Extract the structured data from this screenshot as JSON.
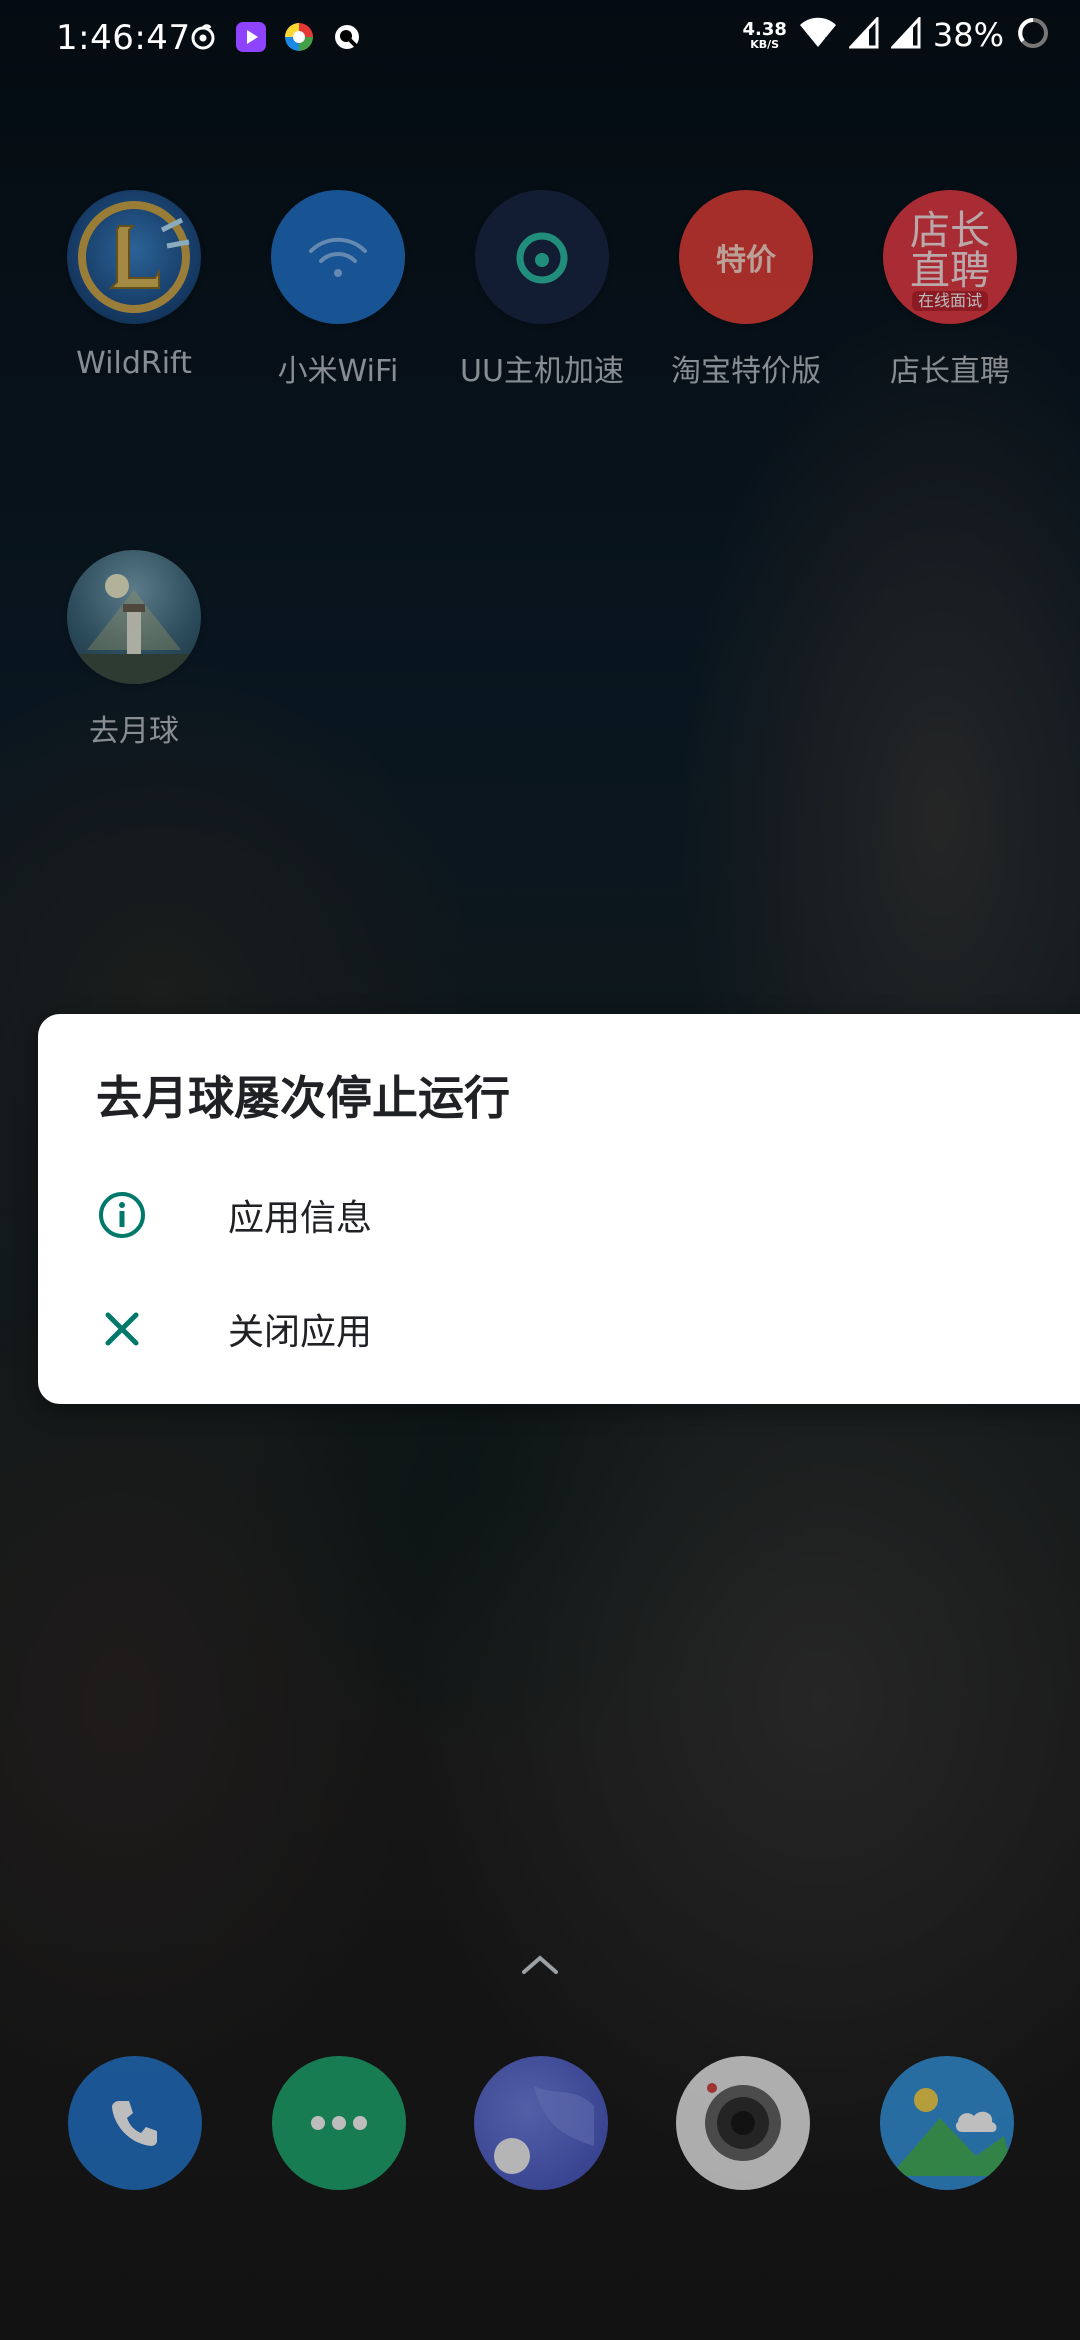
{
  "status_bar": {
    "time": "1:46:47",
    "net_speed_value": "4.38",
    "net_speed_unit": "KB/S",
    "battery": "38%",
    "notification_icons": [
      "netease-music-icon",
      "video-app-icon",
      "colorful-app-icon",
      "q-app-icon"
    ]
  },
  "home": {
    "apps": [
      {
        "label": "WildRift",
        "icon": "wildrift-icon"
      },
      {
        "label": "小米WiFi",
        "icon": "wifi-icon"
      },
      {
        "label": "UU主机加速",
        "icon": "uu-accelerator-icon"
      },
      {
        "label": "淘宝特价版",
        "icon": "taobao-special-icon",
        "icon_text": "特价"
      },
      {
        "label": "店长直聘",
        "icon": "dianzhang-icon",
        "icon_text_1": "店长",
        "icon_text_2": "直聘",
        "icon_text_3": "在线面试"
      },
      {
        "label": "去月球",
        "icon": "to-the-moon-icon"
      }
    ]
  },
  "dialog": {
    "title": "去月球屡次停止运行",
    "options": [
      {
        "label": "应用信息",
        "icon": "info-icon"
      },
      {
        "label": "关闭应用",
        "icon": "close-icon"
      }
    ],
    "accent_color": "#00796B"
  },
  "dock": {
    "apps": [
      "phone-icon",
      "messages-icon",
      "moon-browser-icon",
      "camera-icon",
      "gallery-icon"
    ]
  }
}
